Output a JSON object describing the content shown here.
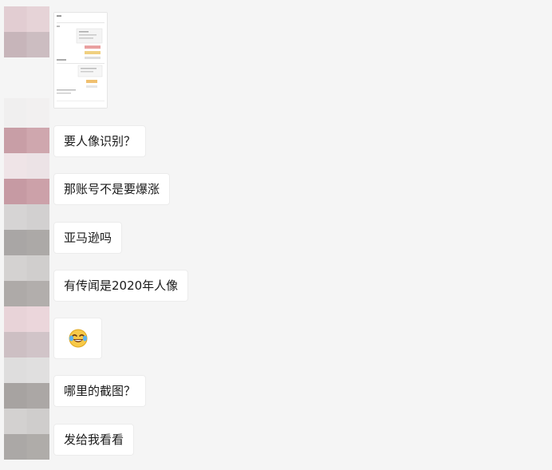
{
  "chat": {
    "messages": [
      {
        "type": "image"
      },
      {
        "type": "text",
        "text": "要人像识别？"
      },
      {
        "type": "text",
        "text": "那账号不是要爆涨"
      },
      {
        "type": "text",
        "text": "亚马逊吗"
      },
      {
        "type": "text",
        "text": "有传闻是2020年人像"
      },
      {
        "type": "emoji",
        "icon": "laughing-tears-emoji-icon"
      },
      {
        "type": "text",
        "text": "哪里的截图？"
      },
      {
        "type": "text",
        "text": "发给我看看"
      }
    ],
    "colors": {
      "background": "#f5f5f5",
      "bubble": "#ffffff",
      "text": "#1a1a1a"
    }
  }
}
